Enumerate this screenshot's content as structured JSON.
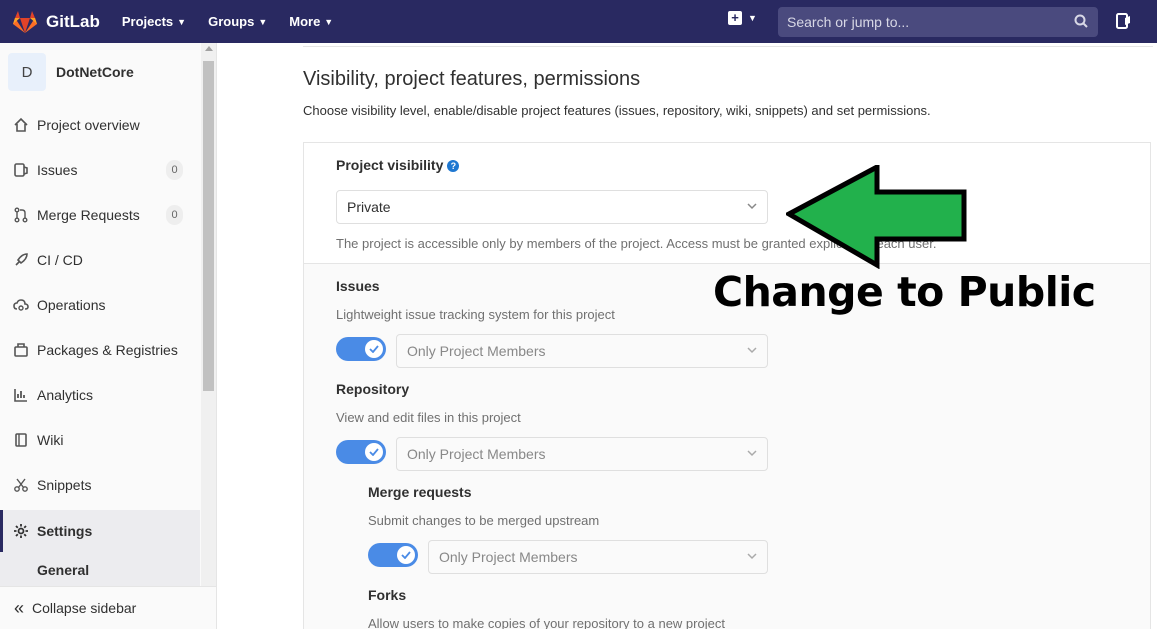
{
  "topbar": {
    "brand": "GitLab",
    "nav": [
      "Projects",
      "Groups",
      "More"
    ],
    "search_placeholder": "Search or jump to..."
  },
  "sidebar": {
    "avatar_letter": "D",
    "project_name": "DotNetCore",
    "items": [
      {
        "label": "Project overview",
        "icon": "home-icon"
      },
      {
        "label": "Issues",
        "icon": "issues-icon",
        "count": "0"
      },
      {
        "label": "Merge Requests",
        "icon": "merge-request-icon",
        "count": "0"
      },
      {
        "label": "CI / CD",
        "icon": "rocket-icon"
      },
      {
        "label": "Operations",
        "icon": "cloud-gear-icon"
      },
      {
        "label": "Packages & Registries",
        "icon": "package-icon"
      },
      {
        "label": "Analytics",
        "icon": "chart-icon"
      },
      {
        "label": "Wiki",
        "icon": "book-icon"
      },
      {
        "label": "Snippets",
        "icon": "scissors-icon"
      },
      {
        "label": "Settings",
        "icon": "gear-icon"
      }
    ],
    "subitem": "General",
    "collapse_label": "Collapse sidebar"
  },
  "main": {
    "title": "Visibility, project features, permissions",
    "description": "Choose visibility level, enable/disable project features (issues, repository, wiki, snippets) and set permissions.",
    "visibility": {
      "label": "Project visibility",
      "value": "Private",
      "help": "The project is accessible only by members of the project. Access must be granted explicitly to each user."
    },
    "features": [
      {
        "title": "Issues",
        "desc": "Lightweight issue tracking system for this project",
        "access": "Only Project Members",
        "enabled": true
      },
      {
        "title": "Repository",
        "desc": "View and edit files in this project",
        "access": "Only Project Members",
        "enabled": true
      },
      {
        "title": "Merge requests",
        "desc": "Submit changes to be merged upstream",
        "access": "Only Project Members",
        "enabled": true
      },
      {
        "title": "Forks",
        "desc": "Allow users to make copies of your repository to a new project"
      }
    ]
  },
  "annotation": {
    "text": "Change to Public",
    "arrow_color": "#22b14c"
  }
}
